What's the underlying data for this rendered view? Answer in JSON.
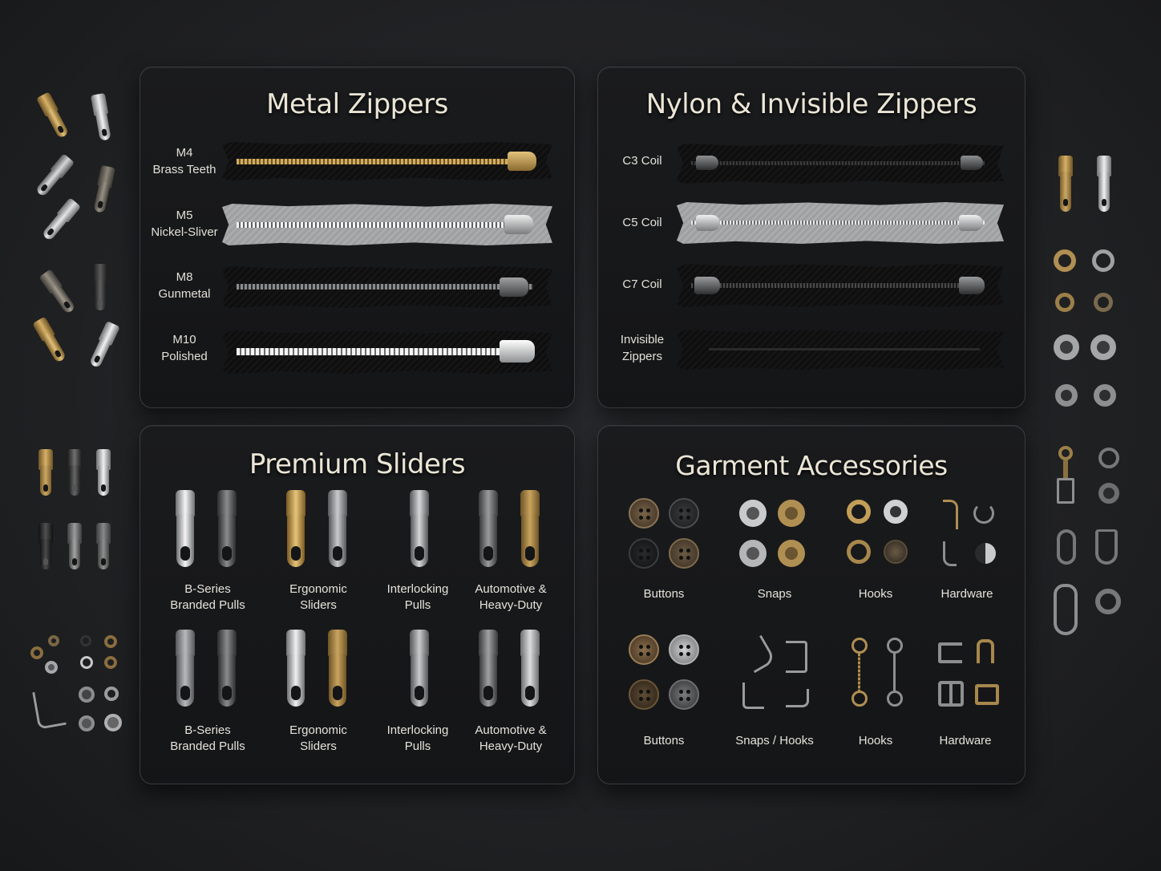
{
  "metal": {
    "title": "Metal Zippers",
    "rows": [
      {
        "line1": "M4",
        "line2": "Brass Teeth"
      },
      {
        "line1": "M5",
        "line2": "Nickel-Sliver"
      },
      {
        "line1": "M8",
        "line2": "Gunmetal"
      },
      {
        "line1": "M10",
        "line2": "Polished"
      }
    ]
  },
  "nylon": {
    "title": "Nylon & Invisible Zippers",
    "rows": [
      {
        "line1": "C3 Coil",
        "line2": ""
      },
      {
        "line1": "C5 Coil",
        "line2": ""
      },
      {
        "line1": "C7 Coil",
        "line2": ""
      },
      {
        "line1": "Invisible",
        "line2": "Zippers"
      }
    ]
  },
  "sliders": {
    "title": "Premium Sliders",
    "items": [
      {
        "line1": "B-Series",
        "line2": "Branded Pulls"
      },
      {
        "line1": "Ergonomic",
        "line2": "Sliders"
      },
      {
        "line1": "Interlocking",
        "line2": "Pulls"
      },
      {
        "line1": "Automotive &",
        "line2": "Heavy-Duty"
      },
      {
        "line1": "B-Series",
        "line2": "Branded Pulls"
      },
      {
        "line1": "Ergonomic",
        "line2": "Sliders"
      },
      {
        "line1": "Interlocking",
        "line2": "Pulls"
      },
      {
        "line1": "Automotive &",
        "line2": "Heavy-Duty"
      }
    ]
  },
  "accessories": {
    "title": "Garment Accessories",
    "items": [
      {
        "label": "Buttons"
      },
      {
        "label": "Snaps"
      },
      {
        "label": "Hooks"
      },
      {
        "label": "Hardware"
      },
      {
        "label": "Buttons"
      },
      {
        "label": "Snaps / Hooks"
      },
      {
        "label": "Hooks"
      },
      {
        "label": "Hardware"
      }
    ]
  },
  "colors": {
    "background": "#1f2022",
    "panel": "#161719",
    "brass": "#b8934a",
    "nickel": "#c9cacb",
    "gunmetal": "#5d5f62",
    "bronze": "#6b5a44"
  }
}
